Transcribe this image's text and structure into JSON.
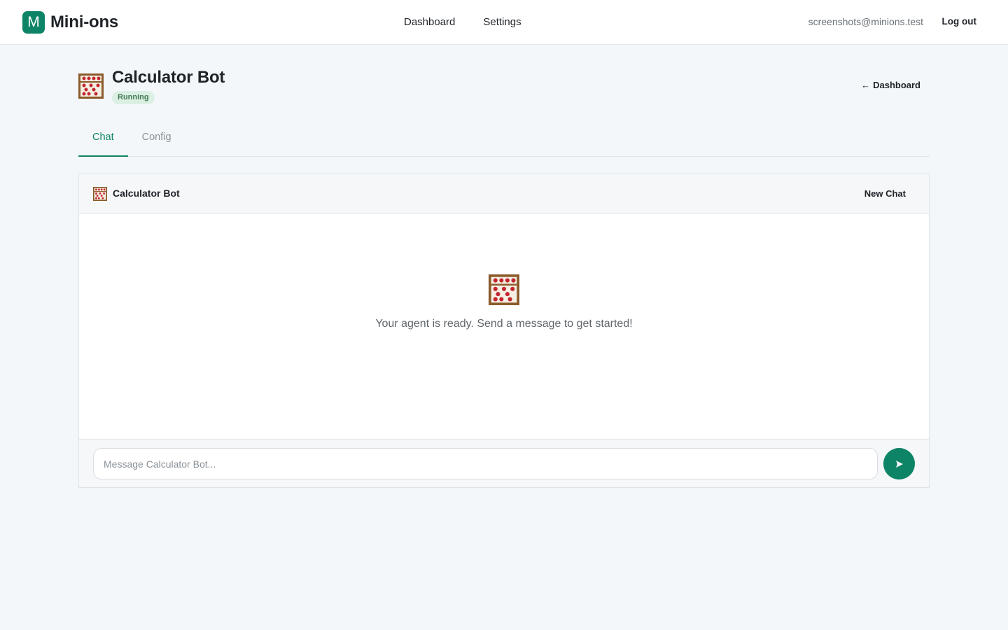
{
  "app": {
    "logo_letter": "M",
    "name": "Mini-ons",
    "brand_color": "#0e8466"
  },
  "nav": {
    "items": [
      {
        "label": "Dashboard"
      },
      {
        "label": "Settings"
      }
    ]
  },
  "user": {
    "email": "screenshots@minions.test",
    "logout_label": "Log out"
  },
  "agent": {
    "icon": "abacus-icon",
    "name": "Calculator Bot",
    "status": "Running",
    "status_color": "#3e7a52",
    "back_label": "Dashboard"
  },
  "tabs": [
    {
      "label": "Chat",
      "active": true
    },
    {
      "label": "Config",
      "active": false
    }
  ],
  "chat": {
    "header_title": "Calculator Bot",
    "new_chat_label": "New Chat",
    "empty_message": "Your agent is ready. Send a message to get started!",
    "input_value": "",
    "input_placeholder": "Message Calculator Bot...",
    "send_icon": "send-arrow-icon"
  }
}
